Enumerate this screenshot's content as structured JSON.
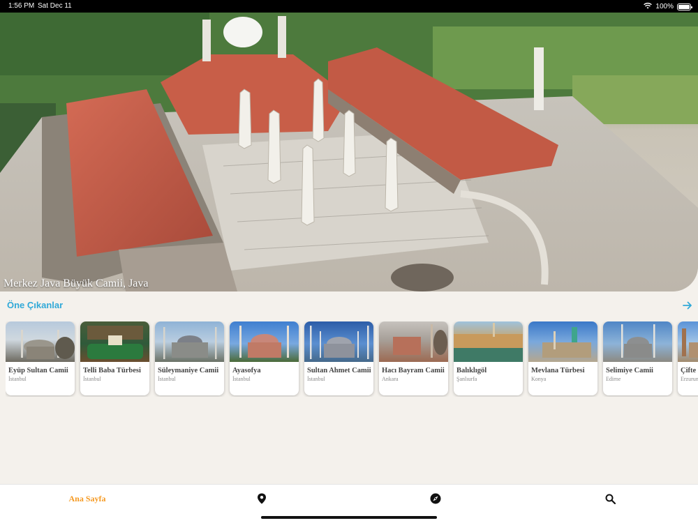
{
  "status_bar": {
    "time": "1:56 PM",
    "date": "Sat Dec 11",
    "battery": "100%",
    "battery_level": 1.0
  },
  "hero": {
    "caption": "Merkez Java Büyük Camii, Java",
    "image_icon": "mosque-aerial-photo"
  },
  "featured": {
    "title": "Öne Çıkanlar",
    "more_icon": "arrow-right-icon",
    "items": [
      {
        "name": "Eyüp Sultan Camii",
        "city": "İstanbul"
      },
      {
        "name": "Telli Baba Türbesi",
        "city": "İstanbul"
      },
      {
        "name": "Süleymaniye Camii",
        "city": "İstanbul"
      },
      {
        "name": "Ayasofya",
        "city": "İstanbul"
      },
      {
        "name": "Sultan Ahmet Camii",
        "city": "İstanbul"
      },
      {
        "name": "Hacı Bayram Camii",
        "city": "Ankara"
      },
      {
        "name": "Balıklıgöl",
        "city": "Şanlıurfa"
      },
      {
        "name": "Mevlana Türbesi",
        "city": "Konya"
      },
      {
        "name": "Selimiye Camii",
        "city": "Edirne"
      },
      {
        "name": "Çifte Minareli Medrese",
        "city": "Erzurum"
      }
    ]
  },
  "tab_bar": {
    "home_label": "Ana Sayfa",
    "map_icon": "location-pin-icon",
    "explore_icon": "compass-icon",
    "search_icon": "search-icon"
  },
  "colors": {
    "accent": "#31a9d8",
    "active_tab": "#f59a23"
  }
}
